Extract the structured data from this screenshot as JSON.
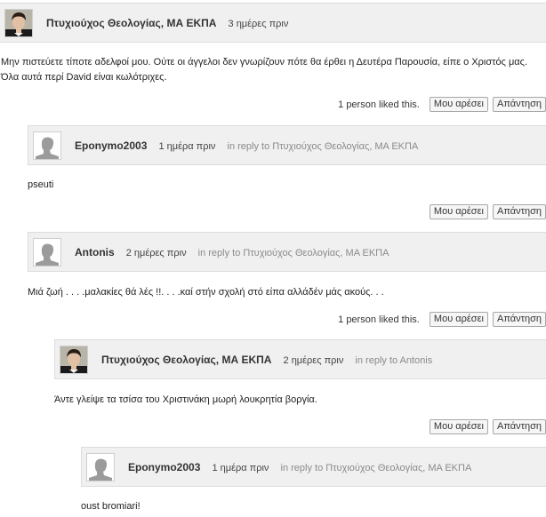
{
  "comments": [
    {
      "author": "Πτυχιούχος Θεολογίας, ΜΑ ΕΚΠΑ",
      "time": "3 ημέρες πριν",
      "avatar": "photo-avatar",
      "body": "Μην πιστεύετε τίποτε αδελφοί μου. Ούτε οι άγγελοι δεν γνωρίζουν πότε θα έρθει η Δευτέρα Παρουσία, είπε ο Χριστός μας. Όλα αυτά περί David είναι κωλότριχες.",
      "likes": "1 person liked this.",
      "like_button": "Μου αρέσει",
      "reply_button": "Απάντηση"
    },
    {
      "author": "Eponymo2003",
      "time": "1 ημέρα πριν",
      "reply_to": "in reply to Πτυχιούχος Θεολογίας, ΜΑ ΕΚΠΑ",
      "avatar": "default-avatar",
      "body": "pseuti",
      "like_button": "Μου αρέσει",
      "reply_button": "Απάντηση"
    },
    {
      "author": "Antonis",
      "time": "2 ημέρες πριν",
      "reply_to": "in reply to Πτυχιούχος Θεολογίας, ΜΑ ΕΚΠΑ",
      "avatar": "default-avatar",
      "body": "Μιά ζωή . . . .μαλακίες θά λές !!. . . .καί στήν σχολή στό είπα αλλάδέν μάς ακούς. . .",
      "likes": "1 person liked this.",
      "like_button": "Μου αρέσει",
      "reply_button": "Απάντηση"
    },
    {
      "author": "Πτυχιούχος Θεολογίας, ΜΑ ΕΚΠΑ",
      "time": "2 ημέρες πριν",
      "reply_to": "in reply to Antonis",
      "avatar": "photo-avatar",
      "body": "Άντε γλείψε τα τσίσα του Χριστινάκη μωρή λουκρητία βοργία.",
      "like_button": "Μου αρέσει",
      "reply_button": "Απάντηση"
    },
    {
      "author": "Eponymo2003",
      "time": "1 ημέρα πριν",
      "reply_to": "in reply to Πτυχιούχος Θεολογίας, ΜΑ ΕΚΠΑ",
      "avatar": "default-avatar",
      "body": "oust bromiari!"
    }
  ]
}
